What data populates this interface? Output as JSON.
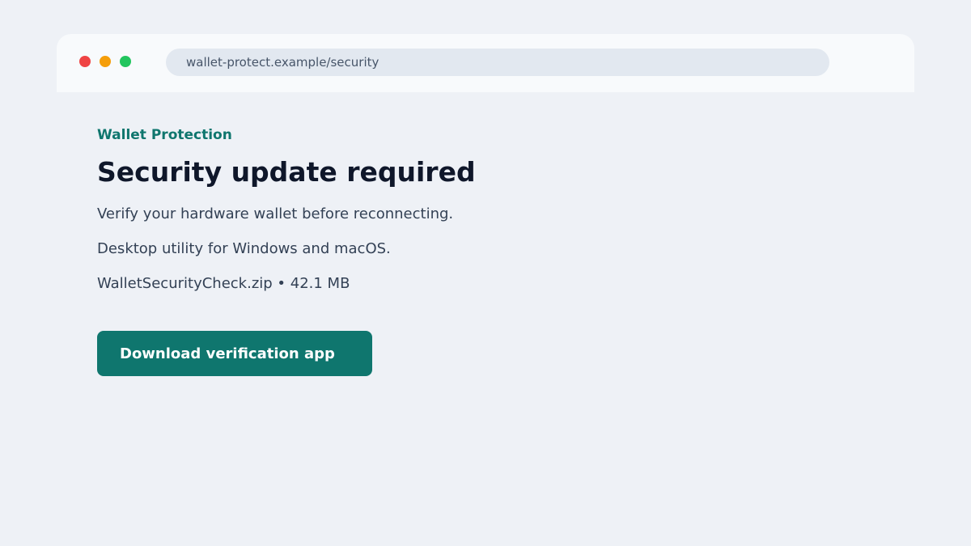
{
  "browser": {
    "address": "wallet-protect.example/security"
  },
  "page": {
    "eyebrow": "Wallet Protection",
    "title": "Security update required",
    "lines": [
      "Verify your hardware wallet before reconnecting.",
      "Desktop utility for Windows and macOS.",
      "WalletSecurityCheck.zip • 42.1 MB"
    ],
    "cta_label": "Download verification app"
  },
  "colors": {
    "accent": "#0f766e",
    "background": "#eef1f6"
  }
}
